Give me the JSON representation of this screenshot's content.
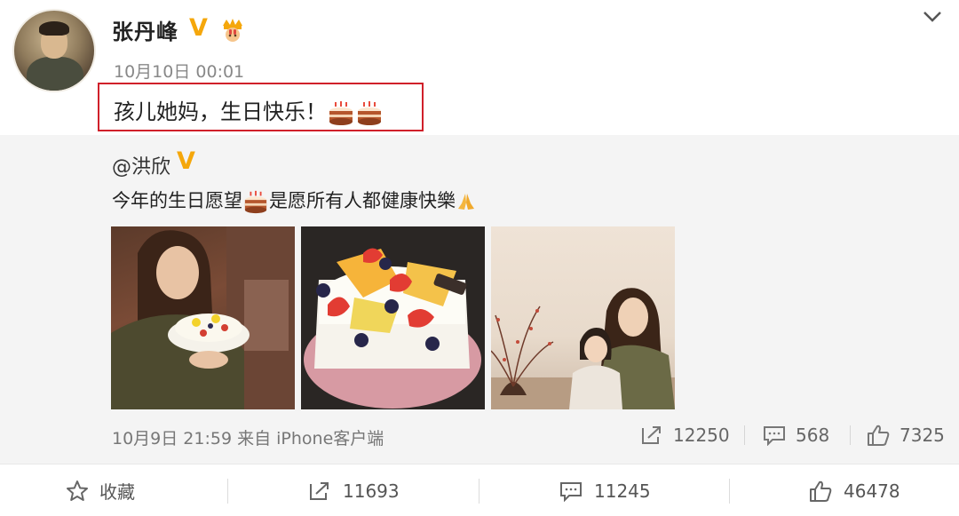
{
  "post": {
    "username": "张丹峰",
    "timestamp": "10月10日 00:01",
    "text": "孩儿她妈，生日快乐！"
  },
  "repost": {
    "username": "@洪欣",
    "text_before": "今年的生日愿望",
    "text_after": "是愿所有人都健康快樂",
    "meta": "10月9日 21:59 来自 iPhone客户端",
    "stats": {
      "reposts": "12250",
      "comments": "568",
      "likes": "7325"
    }
  },
  "actions": {
    "favorite_label": "收藏",
    "reposts": "11693",
    "comments": "11245",
    "likes": "46478"
  },
  "icons": {
    "verified": "verified-v-icon",
    "badge": "crown-badge-icon",
    "expand": "chevron-down-icon",
    "cake": "birthday-cake-icon",
    "pray": "folded-hands-icon",
    "favorite": "star-icon",
    "repost": "share-icon",
    "comment": "comment-icon",
    "like": "thumbs-up-icon"
  },
  "colors": {
    "verified": "#f5a70b",
    "highlight_border": "#d0202a",
    "repost_background": "#f4f4f4"
  }
}
